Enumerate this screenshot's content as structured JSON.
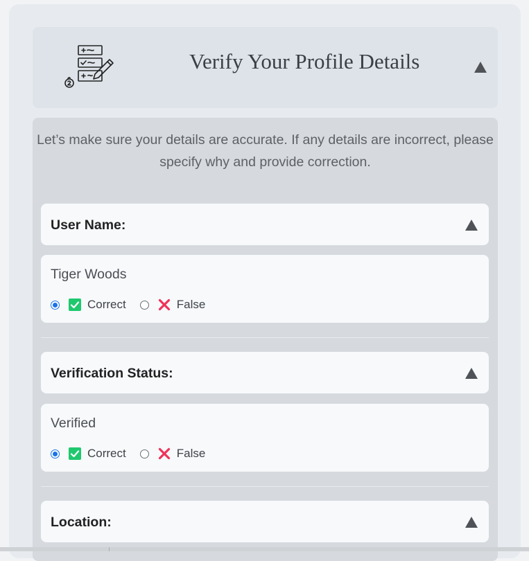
{
  "header": {
    "title": "Verify Your Profile Details",
    "toggle_icon": "triangle-up-icon",
    "illustration": "checklist-pencil-icon"
  },
  "intro_text": "Let’s make sure your details are accurate. If any details are incorrect, please specify why and provide correction.",
  "options": {
    "correct_label": "Correct",
    "false_label": "False",
    "correct_icon": "check-box-icon",
    "false_icon": "cross-icon"
  },
  "fields": [
    {
      "label": "User Name:",
      "value": "Tiger Woods",
      "selected": "Correct"
    },
    {
      "label": "Verification Status:",
      "value": "Verified",
      "selected": "Correct"
    },
    {
      "label": "Location:"
    }
  ],
  "colors": {
    "accent": "#1a73e8",
    "correct_green": "#1fc86e",
    "false_red": "#f0325a"
  }
}
